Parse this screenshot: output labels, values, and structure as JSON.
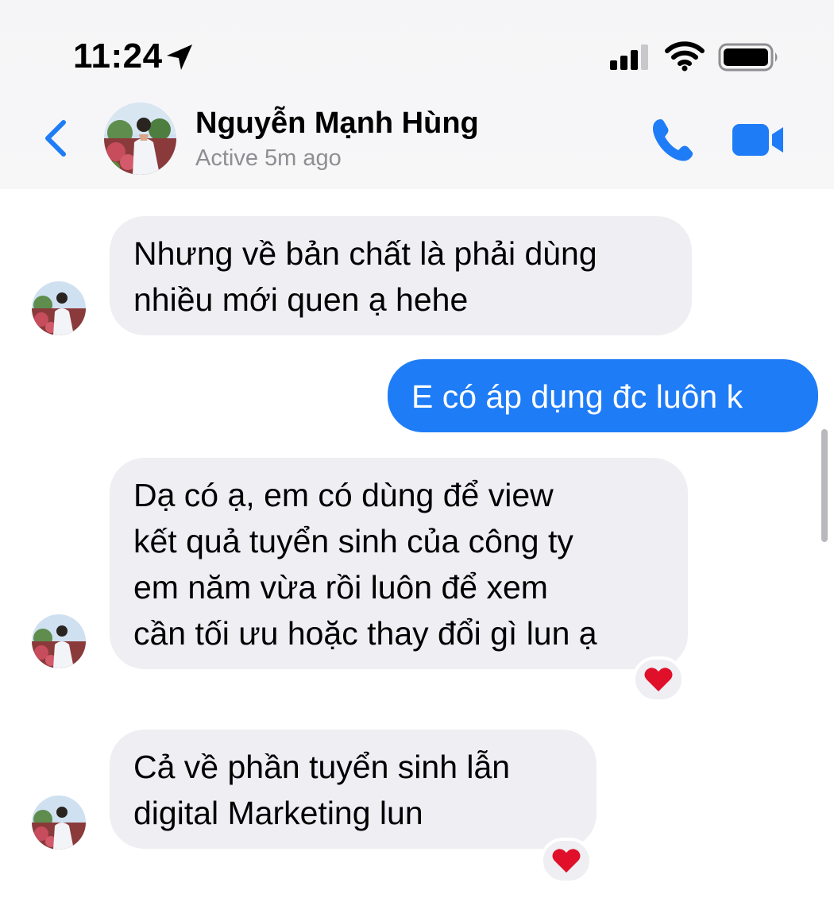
{
  "status_bar": {
    "time": "11:24",
    "icons": [
      "location-arrow-icon",
      "cellular-signal-icon",
      "wifi-icon",
      "battery-icon"
    ]
  },
  "header": {
    "name": "Nguyễn Mạnh Hùng",
    "status": "Active 5m ago",
    "icons": [
      "back-chevron-icon",
      "phone-icon",
      "video-camera-icon"
    ]
  },
  "messages": [
    {
      "sender": "contact",
      "lines": [
        "Nhưng về bản chất là phải dùng",
        "nhiều mới quen ạ hehe"
      ],
      "reaction": null
    },
    {
      "sender": "me",
      "lines": [
        "E có áp dụng đc luôn k"
      ],
      "reaction": null
    },
    {
      "sender": "contact",
      "lines": [
        "Dạ có ạ, em có dùng để view",
        "kết quả tuyển sinh của công ty",
        "em năm vừa rồi luôn để xem",
        "cần tối ưu hoặc thay đổi gì lun ạ"
      ],
      "reaction": "heart"
    },
    {
      "sender": "contact",
      "lines": [
        "Cả về phần tuyển sinh lẫn",
        "digital Marketing lun"
      ],
      "reaction": "heart"
    }
  ],
  "colors": {
    "accent": "#1f7cf7",
    "incoming_bubble": "#eeeef3",
    "reaction_heart": "#e0102a",
    "secondary_text": "#8e8e93"
  }
}
